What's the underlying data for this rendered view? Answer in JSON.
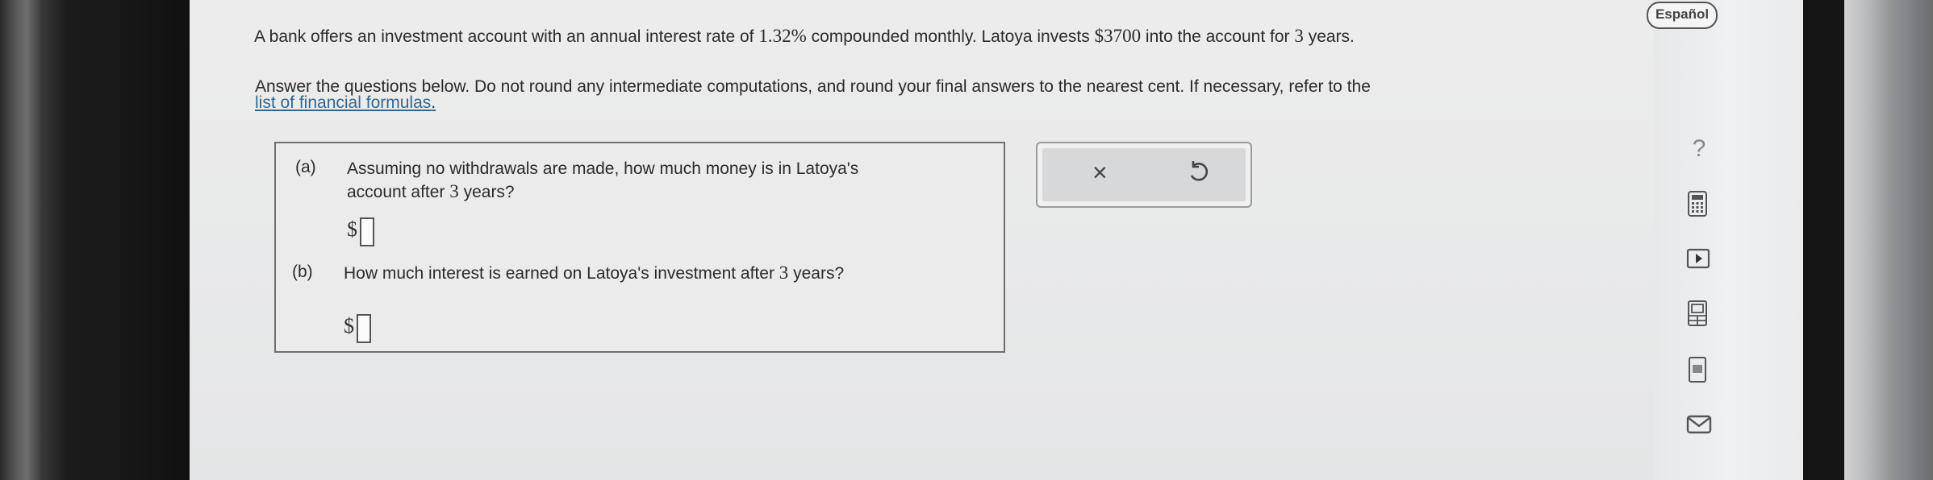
{
  "language_button": "Español",
  "problem": {
    "sentence_before_rate": "A bank offers an investment account with an annual interest rate of ",
    "rate": "1.32%",
    "sentence_after_rate": " compounded monthly. Latoya invests ",
    "amount": "$3700",
    "sentence_after_amount": " into the account for ",
    "years": "3",
    "sentence_end": " years.",
    "instructions": "Answer the questions below. Do not round any intermediate computations, and round your final answers to the nearest cent. If necessary, refer to the",
    "formulas_link": "list of financial formulas",
    "link_period": "."
  },
  "part_a": {
    "label": "(a)",
    "question_line1": "Assuming no withdrawals are made, how much money is in Latoya's",
    "question_line2_before": "account after ",
    "question_years": "3",
    "question_line2_after": " years?",
    "currency": "$",
    "answer_value": ""
  },
  "part_b": {
    "label": "(b)",
    "question_before": "How much interest is earned on Latoya's investment after ",
    "question_years": "3",
    "question_after": " years?",
    "currency": "$",
    "answer_value": ""
  },
  "actions": {
    "clear_symbol": "×"
  },
  "tools": {
    "help_symbol": "?",
    "icons": [
      "calculator-icon",
      "video-icon",
      "periodic-table-icon",
      "glossary-icon",
      "mail-icon"
    ]
  }
}
